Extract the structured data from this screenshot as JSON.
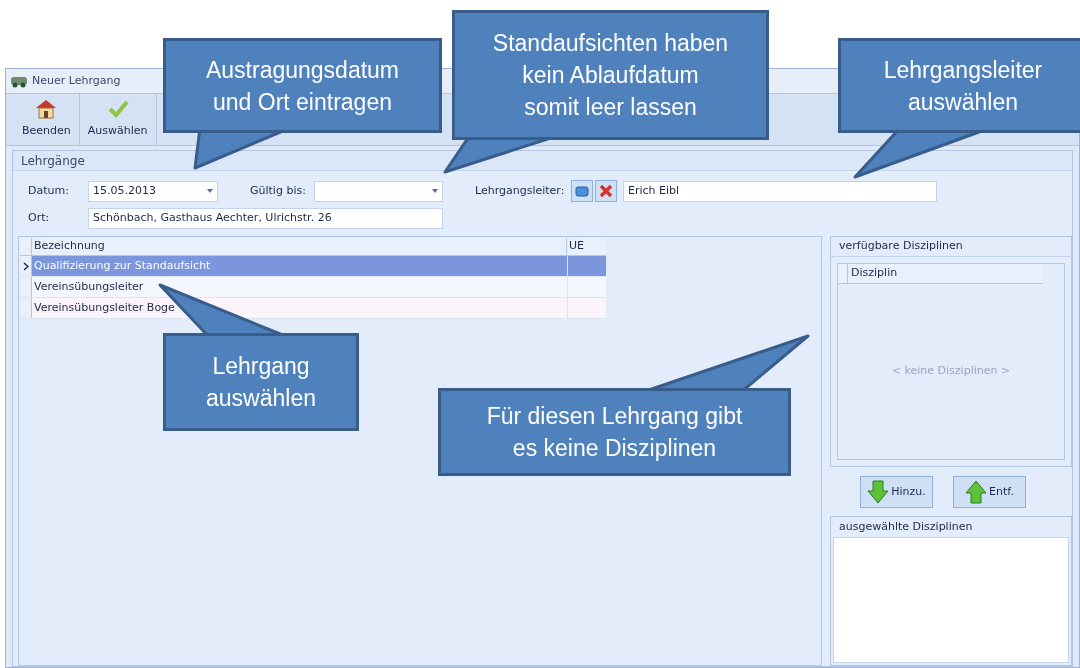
{
  "window": {
    "title": "Neuer Lehrgang"
  },
  "toolbar": [
    {
      "label": "Beenden",
      "kind": "home"
    },
    {
      "label": "Auswählen",
      "kind": "check"
    }
  ],
  "group": {
    "title": "Lehrgänge"
  },
  "form": {
    "datum": {
      "label": "Datum:",
      "value": "15.05.2013"
    },
    "gueltig": {
      "label": "Gültig bis:"
    },
    "leiter": {
      "label": "Lehrgangsleiter:",
      "value": "Erich Eibl"
    },
    "ort": {
      "label": "Ort:",
      "value": "Schönbach, Gasthaus Aechter, Ulrichstr. 26"
    }
  },
  "table": {
    "columns": [
      "Bezeichnung",
      "UE"
    ],
    "rows": [
      {
        "name": "Qualifizierung zur Standaufsicht",
        "selected": true
      },
      {
        "name": "Vereinsübungsleiter",
        "selected": false
      },
      {
        "name": "Vereinsübungsleiter Boge",
        "selected": false
      }
    ]
  },
  "available": {
    "title": "verfügbare Disziplinen",
    "column": "Disziplin",
    "empty": "< keine Disziplinen >"
  },
  "buttons": [
    {
      "label": "Hinzu.",
      "kind": "down"
    },
    {
      "label": "Entf.",
      "kind": "up"
    }
  ],
  "selected_panel": {
    "title": "ausgewählte Disziplinen"
  },
  "callouts": [
    {
      "text": "Austragungsdatum\nund Ort eintragen"
    },
    {
      "text": "Standaufsichten haben\nkein Ablaufdatum\nsomit leer lassen"
    },
    {
      "text": "Lehrgangsleiter\nauswählen"
    },
    {
      "text": "Lehrgang\nauswählen"
    },
    {
      "text": "Für diesen Lehrgang gibt\nes keine Disziplinen"
    }
  ]
}
